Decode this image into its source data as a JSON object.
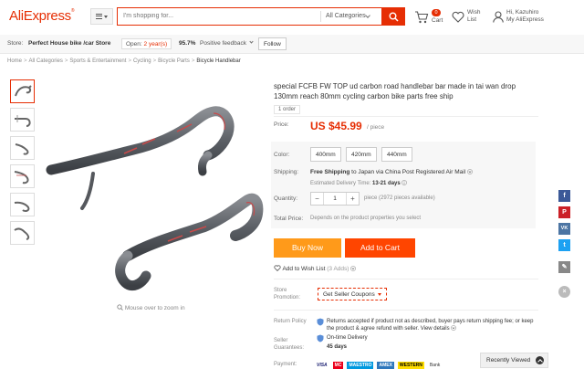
{
  "header": {
    "logo": "AliExpress",
    "logo_mark": "®",
    "search_placeholder": "I'm shopping for...",
    "search_category": "All Categories",
    "cart_count": "0",
    "cart_label": "Cart",
    "wish_label_1": "Wish",
    "wish_label_2": "List",
    "user_greeting": "Hi, Kazuhiro",
    "user_link": "My AliExpress",
    "accent_color": "#e62e04"
  },
  "store": {
    "label": "Store:",
    "name": "Perfect House bike /car Store",
    "open_label": "Open:",
    "open_years": "2 year(s)",
    "feedback_pct": "95.7%",
    "feedback_label": "Positive feedback",
    "follow": "Follow"
  },
  "breadcrumb": [
    "Home",
    "All Categories",
    "Sports & Entertainment",
    "Cycling",
    "Bicycle Parts",
    "Bicycle Handlebar"
  ],
  "gallery": {
    "zoom_hint": "Mouse over to zoom in"
  },
  "product": {
    "title": "special FCFB FW TOP ud carbon road handlebar bar made in tai wan drop 130mm reach 80mm cycling carbon bike parts free ship",
    "orders": "1 order",
    "price_label": "Price:",
    "price": "US $45.99",
    "price_unit": "/ piece",
    "color_label": "Color:",
    "color_options": [
      "400mm",
      "420mm",
      "440mm"
    ],
    "shipping_label": "Shipping:",
    "shipping_free": "Free Shipping",
    "shipping_to": "to Japan via China Post Registered Air Mail",
    "delivery_label": "Estimated Delivery Time:",
    "delivery_time": "13-21 days",
    "quantity_label": "Quantity:",
    "quantity_value": "1",
    "quantity_minus": "−",
    "quantity_plus": "+",
    "quantity_note": "piece (2972 pieces available)",
    "total_label": "Total Price:",
    "total_note": "Depends on the product properties you select",
    "buy_now": "Buy Now",
    "add_to_cart": "Add to Cart",
    "add_wishlist": "Add to Wish List",
    "wishlist_count": "(3 Adds)",
    "promo_label_1": "Store",
    "promo_label_2": "Promotion:",
    "coupon": "Get Seller Coupons",
    "return_label": "Return Policy",
    "return_text": "Returns accepted if product not as described, buyer pays return shipping fee; or keep the product & agree refund with seller.",
    "return_link": "View details",
    "guarantee_label_1": "Seller",
    "guarantee_label_2": "Guarantees:",
    "guarantee_1": "On-time Delivery",
    "guarantee_2": "45 days",
    "payment_label": "Payment:",
    "payments": [
      "VISA",
      "MC",
      "MAESTRO",
      "AMEX",
      "WESTERN",
      "Bank"
    ],
    "buy_color": "#ff9a1a",
    "cart_color": "#ff4500"
  },
  "sidebar": {
    "share_icons": [
      "facebook-icon",
      "pinterest-icon",
      "vk-icon",
      "twitter-icon",
      "edit-icon",
      "close-icon"
    ],
    "recently_viewed": "Recently Viewed"
  }
}
